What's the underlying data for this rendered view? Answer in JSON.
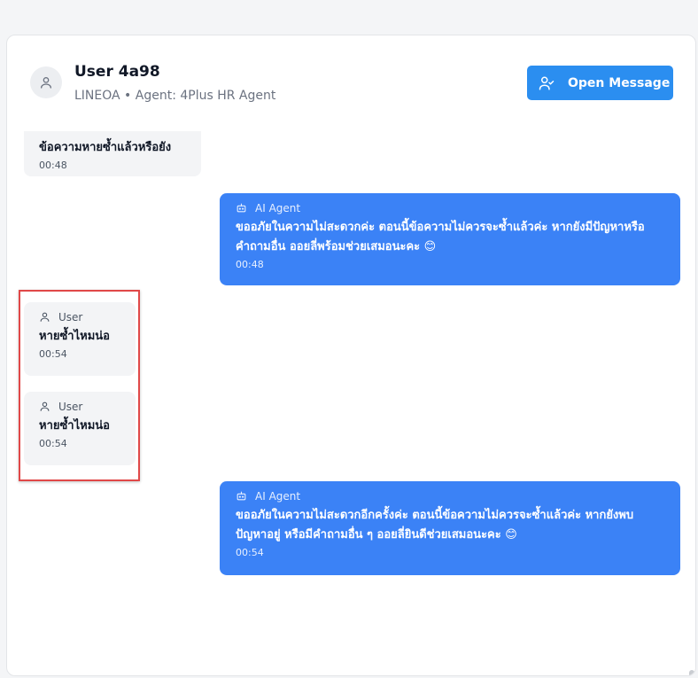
{
  "header": {
    "user_name": "User 4a98",
    "subtitle": "LINEOA • Agent: 4Plus HR Agent",
    "open_button": "Open Message"
  },
  "messages": [
    {
      "role": "user",
      "label": "",
      "text": "ข้อความหายซ้ำแล้วหรือยัง",
      "time": "00:48"
    },
    {
      "role": "ai",
      "label": "AI Agent",
      "text": "ขออภัยในความไม่สะดวกค่ะ ตอนนี้ข้อความไม่ควรจะซ้ำแล้วค่ะ หากยังมีปัญหาหรือคำถามอื่น ออยลี่พร้อมช่วยเสมอนะคะ 😊",
      "time": "00:48"
    },
    {
      "role": "user",
      "label": "User",
      "text": "หายซ้ำไหมน่อ",
      "time": "00:54"
    },
    {
      "role": "user",
      "label": "User",
      "text": "หายซ้ำไหมน่อ",
      "time": "00:54"
    },
    {
      "role": "ai",
      "label": "AI Agent",
      "text": "ขออภัยในความไม่สะดวกอีกครั้งค่ะ ตอนนี้ข้อความไม่ควรจะซ้ำแล้วค่ะ หากยังพบปัญหาอยู่ หรือมีคำถามอื่น ๆ ออยลี่ยินดีช่วยเสมอนะคะ 😊",
      "time": "00:54"
    }
  ],
  "icons": {
    "avatar": "user-icon",
    "open_button": "user-check-icon",
    "user_role": "user-icon",
    "ai_role": "bot-icon"
  },
  "colors": {
    "accent": "#2b8ef0",
    "ai_bubble": "#3b82f6",
    "user_bubble": "#f3f4f6",
    "highlight": "#e04848"
  }
}
